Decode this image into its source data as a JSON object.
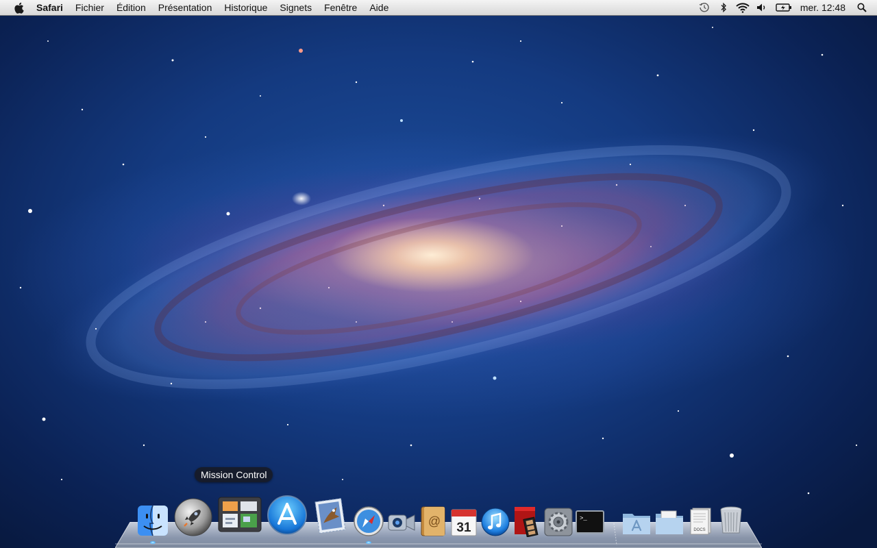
{
  "menubar": {
    "apple_icon": "apple-logo-icon",
    "app_name": "Safari",
    "menus": [
      "Fichier",
      "Édition",
      "Présentation",
      "Historique",
      "Signets",
      "Fenêtre",
      "Aide"
    ],
    "status_icons": [
      "time-machine-icon",
      "bluetooth-icon",
      "wifi-icon",
      "volume-icon",
      "battery-icon"
    ],
    "clock": "mer. 12:48",
    "spotlight_icon": "spotlight-search-icon"
  },
  "wallpaper": {
    "description_icon": "andromeda-galaxy-wallpaper"
  },
  "dock": {
    "tooltip": "Mission Control",
    "items": [
      {
        "name": "finder",
        "icon": "finder-icon",
        "running": true
      },
      {
        "name": "launchpad",
        "icon": "launchpad-rocket-icon",
        "running": false
      },
      {
        "name": "mission-control",
        "icon": "mission-control-icon",
        "running": false
      },
      {
        "name": "app-store",
        "icon": "app-store-icon",
        "running": false
      },
      {
        "name": "mail",
        "icon": "mail-stamp-icon",
        "running": false
      },
      {
        "name": "safari",
        "icon": "safari-compass-icon",
        "running": true
      },
      {
        "name": "facetime",
        "icon": "facetime-camera-icon",
        "running": false
      },
      {
        "name": "address-book",
        "icon": "address-book-icon",
        "running": false
      },
      {
        "name": "ical",
        "icon": "calendar-icon",
        "running": false,
        "label": "31"
      },
      {
        "name": "itunes",
        "icon": "itunes-note-icon",
        "running": false
      },
      {
        "name": "photo-booth",
        "icon": "photo-booth-icon",
        "running": false
      },
      {
        "name": "system-preferences",
        "icon": "gear-icon",
        "running": false
      },
      {
        "name": "terminal",
        "icon": "terminal-icon",
        "running": false
      },
      {
        "name": "applications",
        "icon": "applications-folder-icon",
        "running": false
      },
      {
        "name": "documents",
        "icon": "documents-folder-icon",
        "running": false
      },
      {
        "name": "downloads-stack",
        "icon": "docs-stack-icon",
        "running": false,
        "label": "DOCS"
      },
      {
        "name": "trash",
        "icon": "trash-icon",
        "running": false
      }
    ]
  },
  "colors": {
    "menubar_top": "#f4f4f4",
    "menubar_bottom": "#d8d8d8",
    "sky_deep": "#08193f",
    "sky_mid": "#1d4f9e",
    "galaxy_core": "#fff0d7",
    "indicator": "#4fb2ff"
  }
}
